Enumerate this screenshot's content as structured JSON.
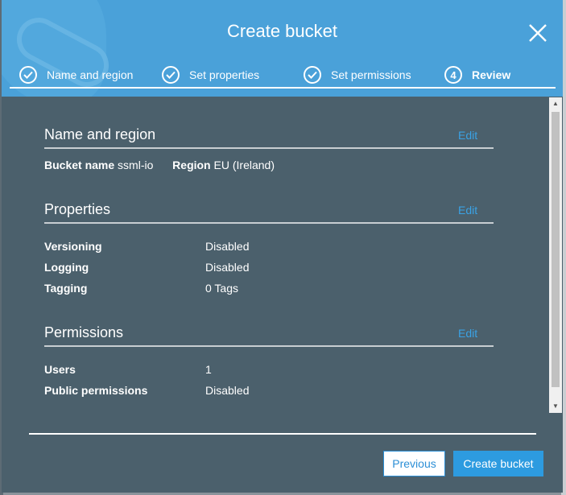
{
  "dialog": {
    "title": "Create bucket"
  },
  "steps": [
    {
      "label": "Name and region",
      "icon": "check-icon"
    },
    {
      "label": "Set properties",
      "icon": "check-icon"
    },
    {
      "label": "Set permissions",
      "icon": "check-icon"
    },
    {
      "label": "Review",
      "number": "4"
    }
  ],
  "sections": {
    "name_region": {
      "title": "Name and region",
      "edit": "Edit",
      "bucket_name_label": "Bucket name",
      "bucket_name_value": "ssml-io",
      "region_label": "Region",
      "region_value": "EU (Ireland)"
    },
    "properties": {
      "title": "Properties",
      "edit": "Edit",
      "rows": [
        {
          "label": "Versioning",
          "value": "Disabled"
        },
        {
          "label": "Logging",
          "value": "Disabled"
        },
        {
          "label": "Tagging",
          "value": "0 Tags"
        }
      ]
    },
    "permissions": {
      "title": "Permissions",
      "edit": "Edit",
      "rows": [
        {
          "label": "Users",
          "value": "1"
        },
        {
          "label": "Public permissions",
          "value": "Disabled"
        }
      ]
    }
  },
  "footer": {
    "previous": "Previous",
    "create": "Create bucket"
  },
  "colors": {
    "header": "#4aa1d9",
    "body": "#4b606c",
    "accent": "#2d9be0",
    "link": "#3aa2e5"
  }
}
